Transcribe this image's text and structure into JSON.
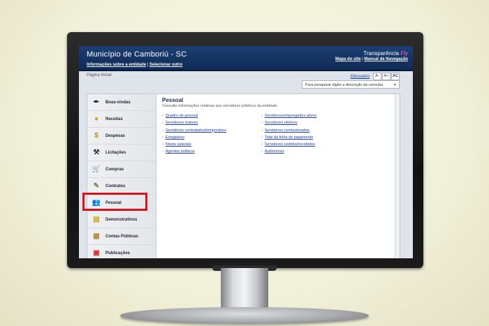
{
  "header": {
    "title": "Município de Camboriú - SC",
    "info_link": "Informações sobre a entidade",
    "select_link": "Selecionar outro",
    "brand_main": "Transparência",
    "brand_accent": "Fly",
    "sitemap_link": "Mapa do site",
    "manual_link": "Manual de Navegação"
  },
  "breadcrumb": "Página Inicial",
  "toolbar": {
    "glossary": "Glossário",
    "font_decrease": "A-",
    "font_increase": "A+",
    "contrast": "AC",
    "search_placeholder": "Para pesquisar digite a descrição da consulta"
  },
  "sidebar": {
    "items": [
      {
        "label": "Boas-vindas",
        "icon": "pen-icon"
      },
      {
        "label": "Receitas",
        "icon": "coins-icon"
      },
      {
        "label": "Despesas",
        "icon": "money-bag-icon"
      },
      {
        "label": "Licitações",
        "icon": "gavel-icon"
      },
      {
        "label": "Compras",
        "icon": "cart-icon"
      },
      {
        "label": "Contratos",
        "icon": "document-icon"
      },
      {
        "label": "Pessoal",
        "icon": "people-icon"
      },
      {
        "label": "Demonstrativos",
        "icon": "report-icon"
      },
      {
        "label": "Contas Públicas",
        "icon": "calculator-icon"
      },
      {
        "label": "Publicações",
        "icon": "newspaper-icon"
      }
    ]
  },
  "main": {
    "title": "Pessoal",
    "subtitle": "Consulte informações relativas aos servidores públicos da entidade.",
    "col1": [
      "Quadro de pessoal",
      "Servidores inativos",
      "Servidores contratados/temporários",
      "Estagiários",
      "Níveis salariais",
      "Agentes políticos"
    ],
    "col2": [
      "Servidores/empregados ativos",
      "Servidores efetivos",
      "Servidores comissionados",
      "Total da folha de pagamento",
      "Servidores cedidos/recebidos",
      "Autônomos"
    ]
  },
  "colors": {
    "header_bg": "#0f2a55",
    "highlight": "#d8131c",
    "link": "#1f3fa0"
  }
}
